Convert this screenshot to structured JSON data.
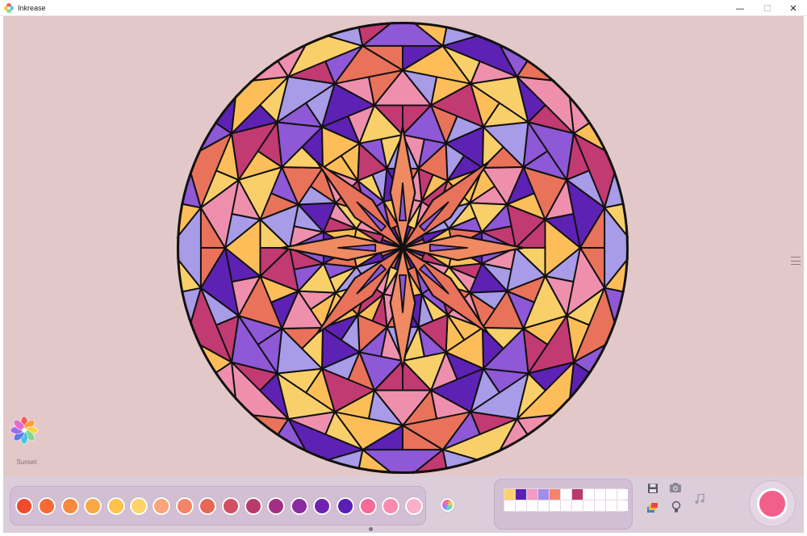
{
  "window": {
    "title": "Inkrease",
    "minimize_glyph": "—",
    "maximize_glyph": "☐",
    "close_glyph": "✕"
  },
  "colors": {
    "canvas_bg": "#e3c8c9",
    "selected_color": "#f25f8a",
    "mandala_outline": "#111111"
  },
  "mandala": {
    "fill_palette": [
      "#f9cf6a",
      "#8e58d6",
      "#5d22b4",
      "#ef8fae",
      "#c23a72",
      "#a89be8",
      "#e8735a",
      "#fdbe5a"
    ]
  },
  "palette_pack": {
    "name": "Sunset",
    "icon": "flower-palette-icon"
  },
  "palette": {
    "swatches": [
      "#f24a2e",
      "#f76a36",
      "#f8893d",
      "#f9a745",
      "#fcc24c",
      "#fdd468",
      "#f9a47a",
      "#f4846a",
      "#e86656",
      "#d24e62",
      "#bb3a6e",
      "#a22f86",
      "#8a2aa2",
      "#7023b0",
      "#5a1fb6",
      "#f56a97",
      "#f88caf",
      "#f9b0c8"
    ],
    "color_wheel_icon": "color-wheel-icon"
  },
  "recent_colors": {
    "filled": [
      "#fdd26a",
      "#5a1fb6",
      "#f59ac2",
      "#a58be8",
      "#f4846a",
      "#ffffff",
      "#bb3a6e"
    ]
  },
  "tools": {
    "save_icon": "save-icon",
    "camera_icon": "camera-icon",
    "music_icon": "music-note-icon",
    "fill_icon": "paint-bucket-icon",
    "hint_icon": "lightbulb-icon"
  }
}
